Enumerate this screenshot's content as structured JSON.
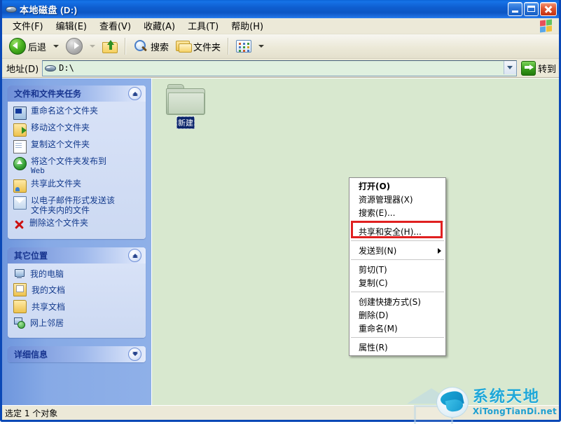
{
  "window": {
    "title": "本地磁盘 (D:)",
    "icon": "hard-drive-icon",
    "minimize_label": "",
    "maximize_label": "",
    "close_label": ""
  },
  "menubar": {
    "items": [
      {
        "label": "文件(F)"
      },
      {
        "label": "编辑(E)"
      },
      {
        "label": "查看(V)"
      },
      {
        "label": "收藏(A)"
      },
      {
        "label": "工具(T)"
      },
      {
        "label": "帮助(H)"
      }
    ]
  },
  "toolbar": {
    "back_label": "后退",
    "forward_label": "",
    "up_label": "",
    "search_label": "搜索",
    "folders_label": "文件夹",
    "views_label": ""
  },
  "addressbar": {
    "label": "地址(D)",
    "value": "D:\\",
    "go_label": "转到"
  },
  "sidebar": {
    "tasks_panel": {
      "title": "文件和文件夹任务",
      "collapse_state": "expanded",
      "items": [
        {
          "label": "重命名这个文件夹",
          "icon": "rename-icon"
        },
        {
          "label": "移动这个文件夹",
          "icon": "move-icon"
        },
        {
          "label": "复制这个文件夹",
          "icon": "copy-icon"
        },
        {
          "label": "将这个文件夹发布到",
          "sub": "Web",
          "icon": "publish-web-icon"
        },
        {
          "label": "共享此文件夹",
          "icon": "share-folder-icon"
        },
        {
          "label": "以电子邮件形式发送该",
          "sub": "文件夹内的文件",
          "icon": "email-icon"
        },
        {
          "label": "删除这个文件夹",
          "icon": "delete-icon"
        }
      ]
    },
    "places_panel": {
      "title": "其它位置",
      "collapse_state": "expanded",
      "items": [
        {
          "label": "我的电脑",
          "icon": "my-computer-icon"
        },
        {
          "label": "我的文档",
          "icon": "my-documents-icon"
        },
        {
          "label": "共享文档",
          "icon": "shared-documents-icon"
        },
        {
          "label": "网上邻居",
          "icon": "network-places-icon"
        }
      ]
    },
    "details_panel": {
      "title": "详细信息",
      "collapse_state": "collapsed"
    }
  },
  "content": {
    "folder_item": {
      "icon": "folder-icon",
      "label": "新建",
      "selected": true
    }
  },
  "context_menu": {
    "items": [
      {
        "label": "打开(O)",
        "bold": true,
        "type": "item"
      },
      {
        "label": "资源管理器(X)",
        "bold": false,
        "type": "item"
      },
      {
        "label": "搜索(E)...",
        "bold": false,
        "type": "item"
      },
      {
        "type": "separator"
      },
      {
        "label": "共享和安全(H)...",
        "bold": false,
        "type": "item",
        "highlighted": true
      },
      {
        "type": "separator"
      },
      {
        "label": "发送到(N)",
        "bold": false,
        "type": "item",
        "submenu": true
      },
      {
        "type": "separator"
      },
      {
        "label": "剪切(T)",
        "bold": false,
        "type": "item"
      },
      {
        "label": "复制(C)",
        "bold": false,
        "type": "item"
      },
      {
        "type": "separator"
      },
      {
        "label": "创建快捷方式(S)",
        "bold": false,
        "type": "item"
      },
      {
        "label": "删除(D)",
        "bold": false,
        "type": "item"
      },
      {
        "label": "重命名(M)",
        "bold": false,
        "type": "item"
      },
      {
        "type": "separator"
      },
      {
        "label": "属性(R)",
        "bold": false,
        "type": "item"
      }
    ],
    "highlight_color": "#e02020"
  },
  "statusbar": {
    "text": "选定 1 个对象"
  },
  "watermark": {
    "main": "系统天地",
    "sub": "XiTongTianDi.net"
  },
  "colors": {
    "titlebar_blue": "#0d56c4",
    "sidebar_blue": "#7fa5e3",
    "content_green": "#d8e8cf",
    "panel_bg": "#d6e0f5",
    "link_text": "#133a8c",
    "highlight_red": "#e02020",
    "watermark_cyan": "#1fa8d8"
  }
}
